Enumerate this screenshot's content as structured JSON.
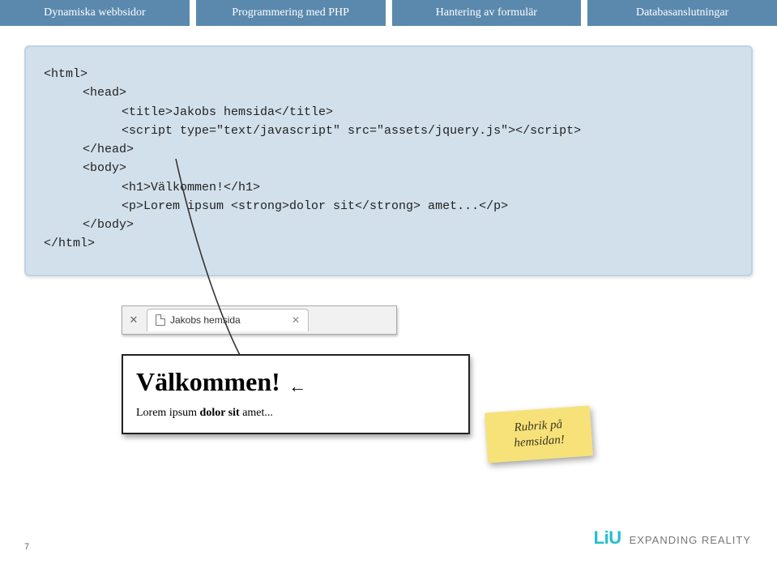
{
  "tabs": {
    "t1": "Dynamiska webbsidor",
    "t2": "Programmering med PHP",
    "t3": "Hantering av formulär",
    "t4": "Databasanslutningar"
  },
  "code": {
    "l1": "<html>",
    "l2": "<head>",
    "l3": "<title>Jakobs hemsida</title>",
    "l4": "<script type=\"text/javascript\" src=\"assets/jquery.js\"></script>",
    "l5": "</head>",
    "l6": "<body>",
    "l7": "<h1>Välkommen!</h1>",
    "l8": "<p>Lorem ipsum <strong>dolor sit</strong> amet...</p>",
    "l9": "</body>",
    "l10": "</html>"
  },
  "browser": {
    "tab_title": "Jakobs hemsida"
  },
  "rendered": {
    "heading": "Välkommen!",
    "para_prefix": "Lorem ipsum ",
    "para_strong": "dolor sit",
    "para_suffix": " amet..."
  },
  "sticky": {
    "line1": "Rubrik på",
    "line2": "hemsidan!"
  },
  "footer": {
    "logo": "LiU",
    "tagline": "EXPANDING REALITY"
  },
  "page_number": "7"
}
